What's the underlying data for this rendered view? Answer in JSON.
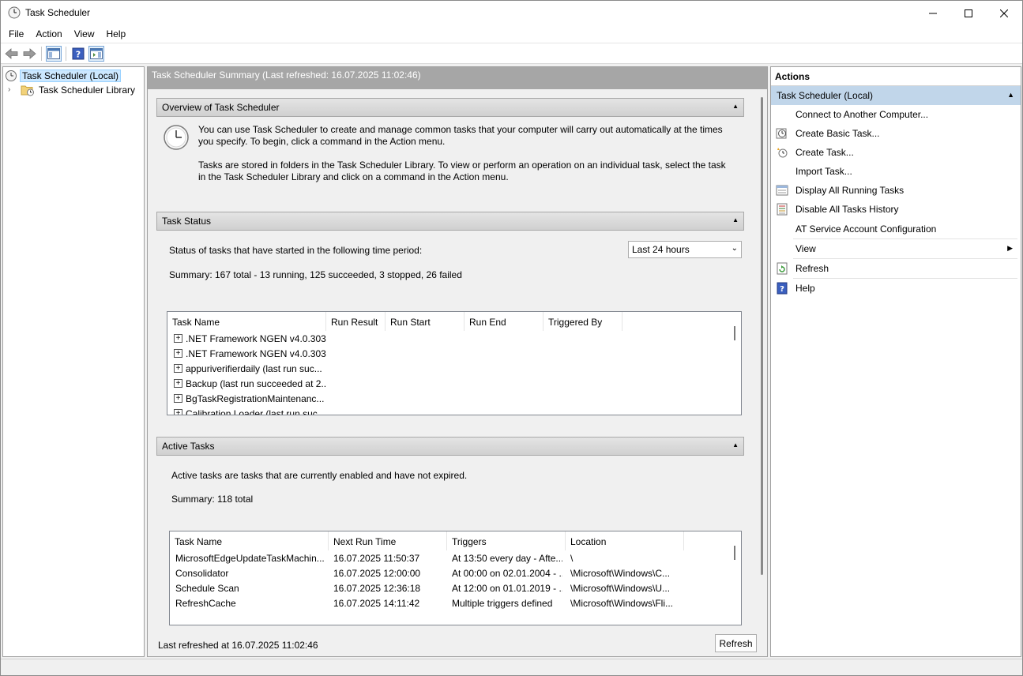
{
  "window": {
    "title": "Task Scheduler"
  },
  "menu": [
    "File",
    "Action",
    "View",
    "Help"
  ],
  "toolbar": {
    "icons": [
      "back-arrow-icon",
      "forward-arrow-icon",
      "show-hide-console-tree-icon",
      "help-icon",
      "show-hide-action-pane-icon"
    ]
  },
  "tree": {
    "root": "Task Scheduler (Local)",
    "child": "Task Scheduler Library"
  },
  "center": {
    "header": "Task Scheduler Summary (Last refreshed: 16.07.2025 11:02:46)",
    "overview": {
      "title": "Overview of Task Scheduler",
      "para1": "You can use Task Scheduler to create and manage common tasks that your computer will carry out automatically at the times you specify. To begin, click a command in the Action menu.",
      "para2": "Tasks are stored in folders in the Task Scheduler Library. To view or perform an operation on an individual task, select the task in the Task Scheduler Library and click on a command in the Action menu."
    },
    "status": {
      "title": "Task Status",
      "period_label": "Status of tasks that have started in the following time period:",
      "period_value": "Last 24 hours",
      "summary": "Summary: 167 total - 13 running, 125 succeeded, 3 stopped, 26 failed",
      "columns": [
        "Task Name",
        "Run Result",
        "Run Start",
        "Run End",
        "Triggered By"
      ],
      "rows": [
        ".NET Framework NGEN v4.0.303...",
        ".NET Framework NGEN v4.0.303...",
        "appuriverifierdaily (last run suc...",
        "Backup (last run succeeded at 2...",
        "BgTaskRegistrationMaintenanc...",
        "Calibration Loader (last run suc..."
      ]
    },
    "active": {
      "title": "Active Tasks",
      "desc": "Active tasks are tasks that are currently enabled and have not expired.",
      "summary": "Summary: 118 total",
      "columns": [
        "Task Name",
        "Next Run Time",
        "Triggers",
        "Location"
      ],
      "rows": [
        {
          "name": "MicrosoftEdgeUpdateTaskMachin...",
          "next": "16.07.2025 11:50:37",
          "triggers": "At 13:50 every day - Afte...",
          "location": "\\"
        },
        {
          "name": "Consolidator",
          "next": "16.07.2025 12:00:00",
          "triggers": "At 00:00 on 02.01.2004 - ...",
          "location": "\\Microsoft\\Windows\\C..."
        },
        {
          "name": "Schedule Scan",
          "next": "16.07.2025 12:36:18",
          "triggers": "At 12:00 on 01.01.2019 - ...",
          "location": "\\Microsoft\\Windows\\U..."
        },
        {
          "name": "RefreshCache",
          "next": "16.07.2025 14:11:42",
          "triggers": "Multiple triggers defined",
          "location": "\\Microsoft\\Windows\\Fli..."
        }
      ]
    },
    "footer": {
      "last_refreshed": "Last refreshed at 16.07.2025 11:02:46",
      "refresh_button": "Refresh"
    }
  },
  "actions": {
    "title": "Actions",
    "group": "Task Scheduler (Local)",
    "items": [
      {
        "label": "Connect to Another Computer...",
        "icon": "none"
      },
      {
        "label": "Create Basic Task...",
        "icon": "create-basic-task-icon"
      },
      {
        "label": "Create Task...",
        "icon": "create-task-icon"
      },
      {
        "label": "Import Task...",
        "icon": "none"
      },
      {
        "label": "Display All Running Tasks",
        "icon": "running-tasks-icon"
      },
      {
        "label": "Disable All Tasks History",
        "icon": "tasks-history-icon"
      },
      {
        "label": "AT Service Account Configuration",
        "icon": "none"
      },
      {
        "label": "View",
        "icon": "none"
      },
      {
        "label": "Refresh",
        "icon": "refresh-icon"
      },
      {
        "label": "Help",
        "icon": "help-icon"
      }
    ]
  }
}
